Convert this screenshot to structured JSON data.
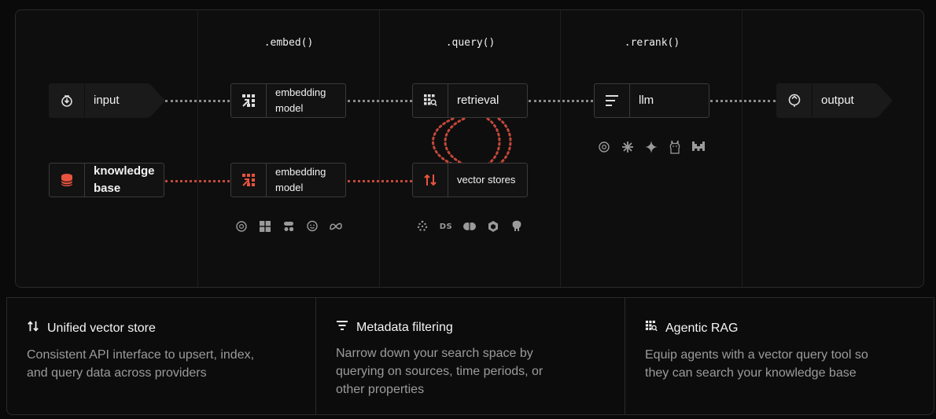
{
  "stages": [
    ".embed()",
    ".query()",
    ".rerank()"
  ],
  "nodes": {
    "input": "input",
    "knowledge_base": "knowledge\nbase",
    "embedding_model_top": "embedding\nmodel",
    "embedding_model_bottom": "embedding\nmodel",
    "retrieval": "retrieval",
    "vector_stores": "vector stores",
    "llm": "llm",
    "output": "output"
  },
  "provider_logos": {
    "embedding": [
      "openai-icon",
      "microsoft-icon",
      "cohere-icon",
      "huggingface-icon",
      "meta-icon"
    ],
    "vector_stores": [
      "pinecone-icon",
      "datastax-icon",
      "chroma-icon",
      "qdrant-icon",
      "postgres-icon"
    ],
    "llm": [
      "openai-icon",
      "anthropic-icon",
      "gemini-icon",
      "llama-icon",
      "mistral-icon"
    ]
  },
  "colors": {
    "accent": "#e8533f",
    "dots": "#8a8a8a",
    "dots_red": "#c4483a"
  },
  "features": [
    {
      "title": "Unified vector store",
      "description": "Consistent API interface to upsert, index, and query data across providers"
    },
    {
      "title": "Metadata filtering",
      "description": "Narrow down your search space by querying on sources, time periods, or other properties"
    },
    {
      "title": "Agentic RAG",
      "description": "Equip agents with a vector query tool so they can search your knowledge base"
    }
  ]
}
